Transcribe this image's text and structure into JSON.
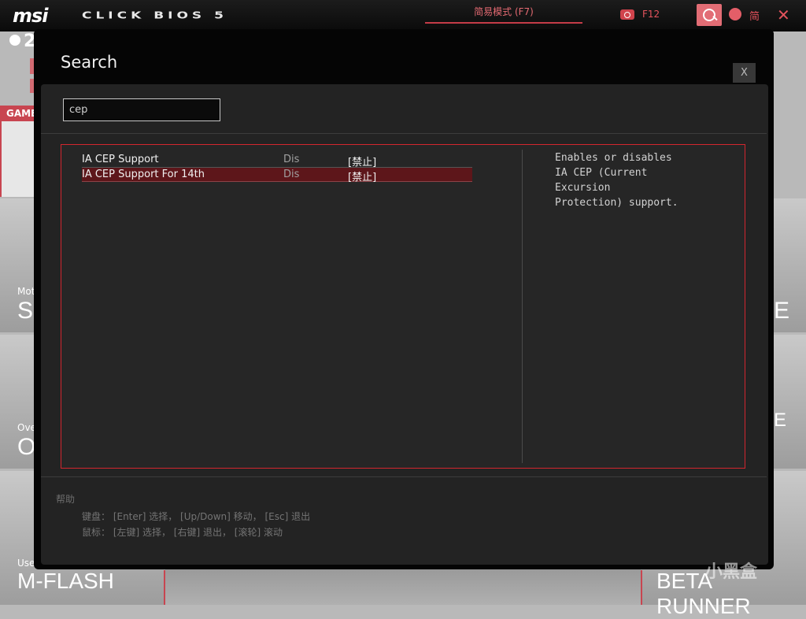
{
  "header": {
    "logo": "msi",
    "title": "CLICK BIOS 5",
    "ez_mode_label": "简易模式 (F7)",
    "screenshot_key": "F12",
    "language": "简",
    "close_glyph": "✕"
  },
  "background": {
    "digit": "2",
    "game_tab": "GAME",
    "tiles": [
      {
        "small": "Mot",
        "big": "SI"
      },
      {
        "small": "Ove",
        "big": "O"
      },
      {
        "small": "Use",
        "big": "M-FLASH"
      }
    ],
    "right_tiles": [
      "E",
      "E",
      "BETA RUNNER"
    ]
  },
  "modal": {
    "title": "Search",
    "close_label": "X",
    "search_value": "cep",
    "results": [
      {
        "name": "IA CEP Support",
        "value": "Dis",
        "option": "[禁止]",
        "selected": false
      },
      {
        "name": "IA CEP Support For 14th",
        "value": "Dis",
        "option": "[禁止]",
        "selected": true
      }
    ],
    "description": "Enables or disables\nIA CEP (Current\nExcursion\nProtection) support.",
    "help": {
      "title": "帮助",
      "keyboard": "键盘： [Enter] 选择， [Up/Down] 移动， [Esc] 退出",
      "mouse": "鼠标： [左键] 选择， [右键] 退出， [滚轮] 滚动"
    }
  },
  "watermark": "小黑盒",
  "colors": {
    "accent": "#d3262e",
    "selected_row": "#5d161a",
    "header_accent": "#e4525c"
  }
}
